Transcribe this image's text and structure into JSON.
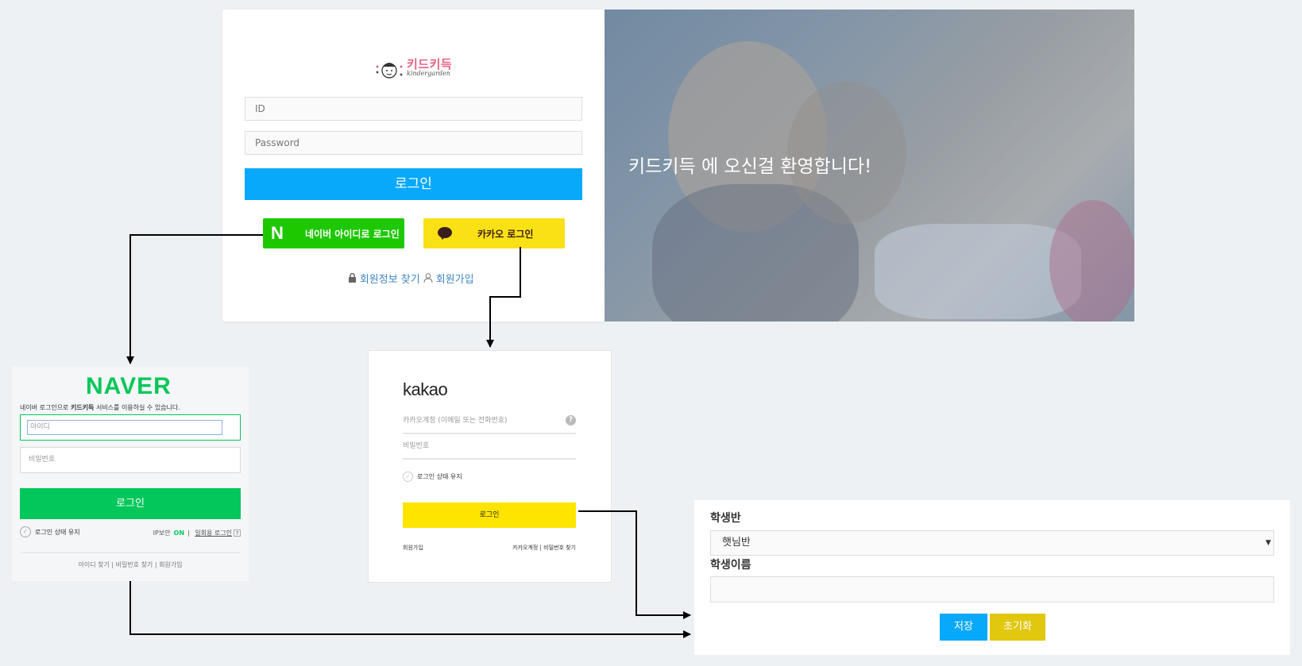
{
  "login_card": {
    "logo": {
      "brand": "키드키득",
      "sub": "kindergarden"
    },
    "id_placeholder": "ID",
    "password_placeholder": "Password",
    "login_button": "로그인",
    "naver_button": "네이버 아이디로 로그인",
    "kakao_button": "카카오 로그인",
    "find_info_link": "회원정보 찾기",
    "signup_link": "회원가입"
  },
  "hero": {
    "welcome_text": "키드키득 에 오신걸 환영합니다!"
  },
  "naver_panel": {
    "logo": "NAVER",
    "desc_prefix": "네이버 로그인으로 ",
    "desc_brand": "키드키득",
    "desc_suffix": " 서비스를 이용하실 수 있습니다.",
    "id_placeholder": "아이디",
    "password_placeholder": "비밀번호",
    "login_button": "로그인",
    "keep_login": "로그인 상태 유지",
    "ip_security": "IP보안",
    "ip_on": "ON",
    "one_time_login": "일회용 로그인",
    "help": "?",
    "footer": "아이디 찾기  |  비밀번호 찾기  |  회원가입"
  },
  "kakao_panel": {
    "logo": "kakao",
    "account_placeholder": "카카오계정 (이메일 또는 전화번호)",
    "help": "?",
    "password_placeholder": "비밀번호",
    "keep_login": "로그인 상태 유지",
    "login_button": "로그인",
    "signup": "회원가입",
    "footer_right": "카카오계정  |  비밀번호 찾기"
  },
  "form_panel": {
    "class_label": "학생반",
    "class_selected": "햇님반",
    "name_label": "학생이름",
    "save_button": "저장",
    "reset_button": "초기화"
  },
  "colors": {
    "primary": "#08a9fb",
    "naver_green": "#03c75a",
    "kakao_yellow": "#fee500",
    "reset_yellow": "#e1c70e"
  }
}
